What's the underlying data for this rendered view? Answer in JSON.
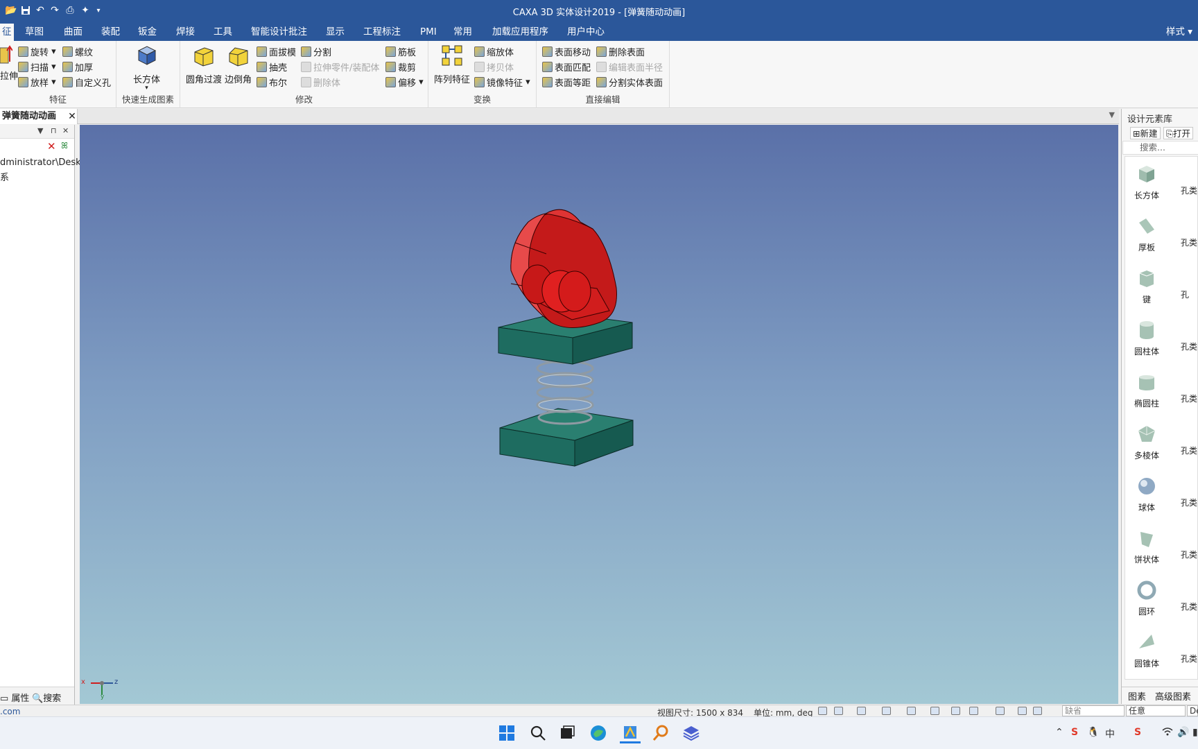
{
  "window": {
    "title": "CAXA 3D 实体设计2019 - [弹簧随动动画]"
  },
  "menu": {
    "tabs": [
      "征",
      "草图",
      "曲面",
      "装配",
      "钣金",
      "焊接",
      "工具",
      "智能设计批注",
      "显示",
      "工程标注",
      "PMI",
      "常用",
      "加载应用程序",
      "用户中心"
    ],
    "right": "样式"
  },
  "ribbon": {
    "feature": {
      "label": "特征",
      "stretch": "拉伸",
      "rotate": "旋转",
      "thread": "螺纹",
      "sweep": "扫描",
      "thicken": "加厚",
      "loft": "放样",
      "custom_hole": "自定义孔"
    },
    "quick": {
      "label": "快速生成图素",
      "box": "长方体"
    },
    "modify": {
      "label": "修改",
      "round": "圆角过渡",
      "chamfer": "边倒角",
      "draft": "面拔模",
      "shell": "抽壳",
      "boolean": "布尔",
      "split": "分割",
      "stretch_part": "拉伸零件/装配体",
      "delete_body": "删除体",
      "rib": "筋板",
      "trim": "裁剪",
      "offset": "偏移"
    },
    "transform": {
      "label": "变换",
      "pattern": "阵列特征",
      "scale": "缩放体",
      "copy": "拷贝体",
      "mirror": "镜像特征"
    },
    "direct": {
      "label": "直接编辑",
      "move_face": "表面移动",
      "match_face": "表面匹配",
      "offset_face": "表面等距",
      "delete_face": "删除表面",
      "edit_radius": "编辑表面半径",
      "split_face": "分割实体表面"
    }
  },
  "document": {
    "tab": "弹簧随动动画"
  },
  "left_panel": {
    "path": "dministrator\\Deskt",
    "item2": "系",
    "bottom_props": "属性",
    "bottom_search": "搜索",
    "status_text": ".com"
  },
  "right_panel": {
    "title": "设计元素库",
    "new": "新建",
    "open": "打开",
    "search_placeholder": "搜索...",
    "elements": [
      "长方体",
      "厚板",
      "键",
      "圆柱体",
      "椭圆柱",
      "多棱体",
      "球体",
      "饼状体",
      "圆环",
      "圆锥体"
    ],
    "elements_right": [
      "孔类",
      "孔类",
      "孔",
      "孔类",
      "孔类",
      "孔类",
      "孔类",
      "孔类",
      "孔类",
      "孔类"
    ],
    "tab_elements": "图素",
    "tab_advanced": "高级图素"
  },
  "status": {
    "view_size": "视图尺寸: 1500 x 834",
    "units": "单位: mm, deg",
    "field1": "缺省",
    "field2": "任意",
    "field3": "De"
  },
  "axis": {
    "x": "x",
    "y": "y",
    "z": "z"
  },
  "colors": {
    "title_bg": "#2b579a",
    "cam_red": "#d21e1e",
    "base_green": "#1c6a5e",
    "spring": "#8f9aa3"
  }
}
